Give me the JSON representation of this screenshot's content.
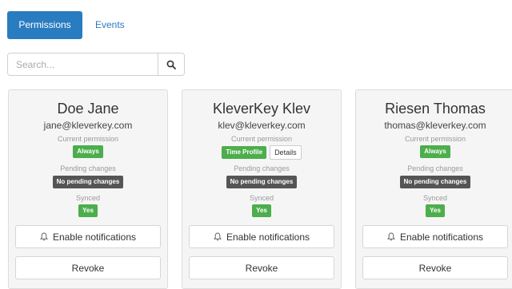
{
  "tabs": [
    {
      "label": "Permissions",
      "active": true
    },
    {
      "label": "Events",
      "active": false
    }
  ],
  "search": {
    "placeholder": "Search...",
    "icon": "search-icon"
  },
  "labels": {
    "current_permission": "Current permission",
    "pending_changes": "Pending changes",
    "synced": "Synced",
    "enable_notifications": "Enable notifications",
    "revoke": "Revoke",
    "details": "Details"
  },
  "colors": {
    "accent": "#2a7cc0",
    "status_green": "#4cae4c",
    "status_dark": "#555555",
    "card_bg": "#f5f5f5"
  },
  "users": [
    {
      "name": "Doe Jane",
      "email": "jane@kleverkey.com",
      "permission": "Always",
      "pending": "No pending changes",
      "synced": "Yes",
      "has_details": false
    },
    {
      "name": "KleverKey Klev",
      "email": "klev@kleverkey.com",
      "permission": "Time Profile",
      "pending": "No pending changes",
      "synced": "Yes",
      "has_details": true
    },
    {
      "name": "Riesen Thomas",
      "email": "thomas@kleverkey.com",
      "permission": "Always",
      "pending": "No pending changes",
      "synced": "Yes",
      "has_details": false
    }
  ]
}
